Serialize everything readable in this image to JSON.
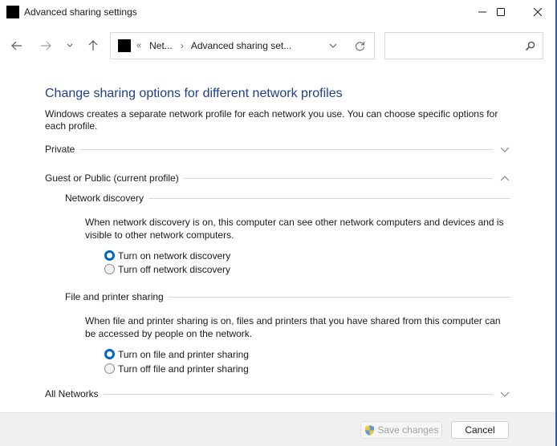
{
  "window": {
    "title": "Advanced sharing settings",
    "controls": {
      "minimize": "minimize-icon",
      "maximize": "maximize-icon",
      "close": "close-icon"
    }
  },
  "nav": {
    "back": "back-arrow-icon",
    "forward": "forward-arrow-icon",
    "recent": "chevron-down-icon",
    "up": "up-arrow-icon",
    "address": {
      "overflow": "«",
      "crumbs": [
        "Net...",
        "Advanced sharing set..."
      ],
      "separator": "›"
    },
    "search": {
      "value": "",
      "placeholder": ""
    }
  },
  "content": {
    "heading": "Change sharing options for different network profiles",
    "description": "Windows creates a separate network profile for each network you use. You can choose specific options for each profile.",
    "profiles": [
      {
        "label": "Private",
        "expanded": false
      },
      {
        "label": "Guest or Public (current profile)",
        "expanded": true
      },
      {
        "label": "All Networks",
        "expanded": false
      }
    ],
    "network_discovery": {
      "title": "Network discovery",
      "description": "When network discovery is on, this computer can see other network computers and devices and is visible to other network computers.",
      "options": [
        {
          "label": "Turn on network discovery",
          "selected": true
        },
        {
          "label": "Turn off network discovery",
          "selected": false
        }
      ]
    },
    "file_printer_sharing": {
      "title": "File and printer sharing",
      "description": "When file and printer sharing is on, files and printers that you have shared from this computer can be accessed by people on the network.",
      "options": [
        {
          "label": "Turn on file and printer sharing",
          "selected": true
        },
        {
          "label": "Turn off file and printer sharing",
          "selected": false
        }
      ]
    }
  },
  "footer": {
    "save_label": "Save changes",
    "save_icon": "uac-shield-icon",
    "cancel_label": "Cancel"
  }
}
